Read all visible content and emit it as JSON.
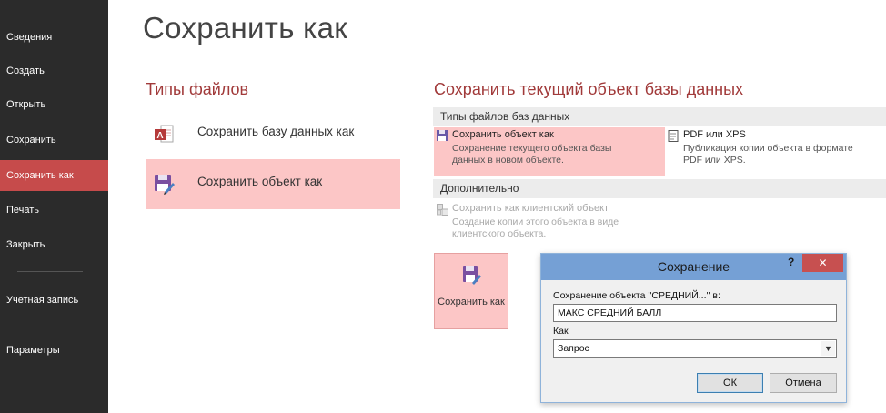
{
  "nav": {
    "items": [
      {
        "label": "Сведения"
      },
      {
        "label": "Создать"
      },
      {
        "label": "Открыть"
      },
      {
        "label": "Сохранить"
      },
      {
        "label": "Сохранить как",
        "active": true
      },
      {
        "label": "Печать"
      },
      {
        "label": "Закрыть"
      }
    ],
    "account_label": "Учетная запись",
    "options_label": "Параметры"
  },
  "page": {
    "title": "Сохранить как"
  },
  "file_types": {
    "title": "Типы файлов",
    "items": [
      {
        "label": "Сохранить базу данных как",
        "icon": "access-database-icon"
      },
      {
        "label": "Сохранить объект как",
        "icon": "save-object-icon",
        "selected": true
      }
    ]
  },
  "save_object": {
    "title": "Сохранить текущий объект базы данных",
    "db_file_types_header": "Типы файлов баз данных",
    "options": [
      {
        "title": "Сохранить объект как",
        "desc1": "Сохранение текущего объекта базы",
        "desc2": "данных в новом объекте.",
        "icon": "save-icon",
        "selected": true
      },
      {
        "title": "PDF или XPS",
        "desc1": "Публикация копии объекта в формате",
        "desc2": "PDF или XPS.",
        "icon": "pdf-icon"
      }
    ],
    "additional_header": "Дополнительно",
    "client_option": {
      "title": "Сохранить как клиентский объект",
      "desc1": "Создание копии этого объекта в виде",
      "desc2": "клиентского объекта.",
      "icon": "client-object-icon",
      "disabled": true
    },
    "save_as_button_label": "Сохранить как"
  },
  "dialog": {
    "title": "Сохранение",
    "help_label": "?",
    "close_label": "✕",
    "object_label": "Сохранение объекта ''СРЕДНИЙ...'' в:",
    "name_value": "МАКС СРЕДНИЙ БАЛЛ",
    "as_label": "Как",
    "as_value": "Запрос",
    "ok_label": "ОК",
    "cancel_label": "Отмена"
  },
  "colors": {
    "sidebar_bg": "#2b2b2b",
    "accent": "#c64b4b",
    "selection": "#fcc6c6",
    "title_red": "#a13a3a",
    "dialog_title_bar": "#75a0d5"
  }
}
